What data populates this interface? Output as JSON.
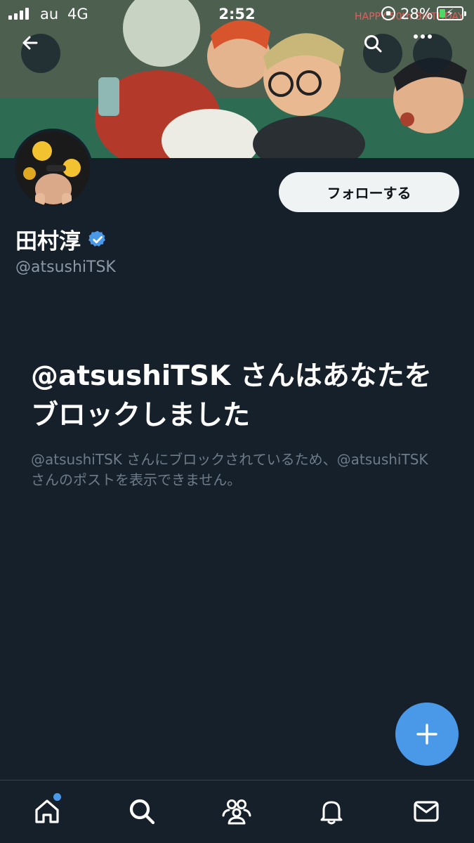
{
  "status_bar": {
    "carrier": "au",
    "network": "4G",
    "time": "2:52",
    "battery_percent": "28%",
    "battery_level": 0.28
  },
  "banner": {
    "back_icon": "arrow-left-icon",
    "search_icon": "search-icon",
    "more_icon": "more-horizontal-icon",
    "banner_text": "HAPPY 50th BIRTHDAY"
  },
  "profile": {
    "display_name": "田村淳",
    "verified": true,
    "handle": "@atsushiTSK",
    "follow_label": "フォローする"
  },
  "blocked": {
    "title": "@atsushiTSK さんはあなたをブロックしました",
    "description": "@atsushiTSK さんにブロックされているため、@atsushiTSK さんのポストを表示できません。"
  },
  "compose": {
    "icon": "plus-icon"
  },
  "bottom_nav": {
    "items": [
      {
        "name": "home",
        "icon": "home-icon",
        "has_notification_dot": true
      },
      {
        "name": "search",
        "icon": "search-icon"
      },
      {
        "name": "communities",
        "icon": "communities-icon"
      },
      {
        "name": "notifications",
        "icon": "bell-icon"
      },
      {
        "name": "messages",
        "icon": "mail-icon"
      }
    ]
  },
  "colors": {
    "background": "#15202b",
    "accent": "#4a99e9",
    "secondary_text": "#8b98a5",
    "follow_button_bg": "#eff3f4"
  }
}
